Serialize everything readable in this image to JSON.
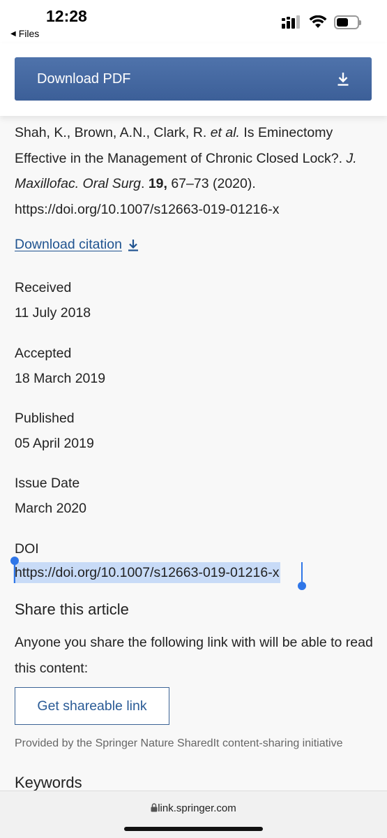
{
  "status": {
    "time": "12:28",
    "back_label": "Files",
    "battery_level": 0.58
  },
  "header": {
    "download_pdf_label": "Download PDF",
    "download_icon": "download-icon"
  },
  "citation": {
    "authors": "Shah, K., Brown, A.N., Clark, R. ",
    "et_al": "et al.",
    "title": " Is Eminectomy Effective in the Management of Chronic Closed Lock?. ",
    "journal": "J. Maxillofac. Oral Surg",
    "journal_sep": ". ",
    "volume": "19,",
    "pages_year": " 67–73 (2020).",
    "doi_url": "https://doi.org/10.1007/s12663-019-01216-x",
    "download_citation_label": "Download citation"
  },
  "dates": [
    {
      "label": "Received",
      "value": "11 July 2018"
    },
    {
      "label": "Accepted",
      "value": "18 March 2019"
    },
    {
      "label": "Published",
      "value": "05 April 2019"
    },
    {
      "label": "Issue Date",
      "value": "March 2020"
    }
  ],
  "doi": {
    "label": "DOI",
    "value": "https://doi.org/10.1007/s12663-019-01216-x"
  },
  "share": {
    "title": "Share this article",
    "text": "Anyone you share the following link with will be able to read this content:",
    "button_label": "Get shareable link",
    "provided_by": "Provided by the Springer Nature SharedIt content-sharing initiative"
  },
  "keywords_heading": "Keywords",
  "browser": {
    "url": "link.springer.com"
  },
  "colors": {
    "accent": "#3c5f98",
    "link": "#1f5390",
    "selection": "#c8dbf7",
    "handle": "#2f76e8"
  }
}
